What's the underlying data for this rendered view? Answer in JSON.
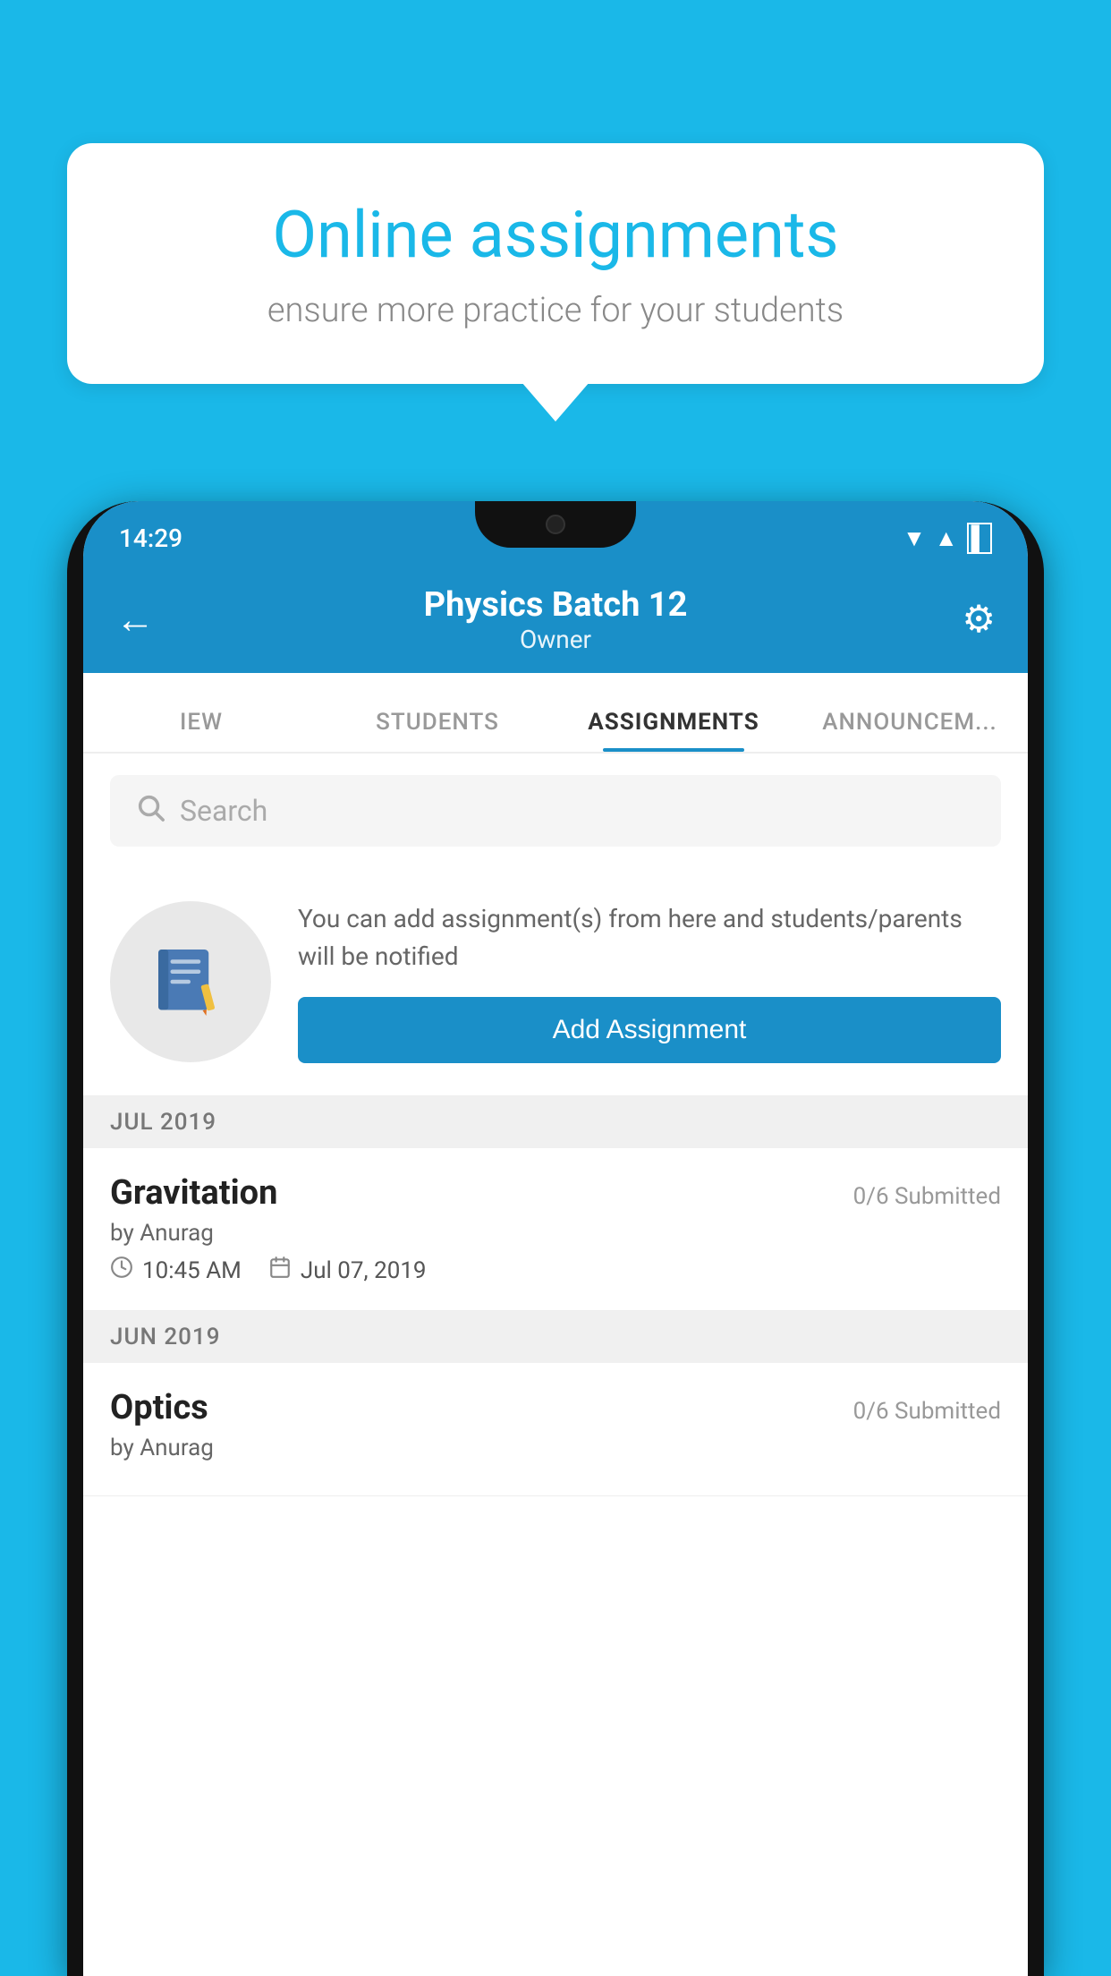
{
  "background_color": "#1ab8e8",
  "speech_bubble": {
    "title": "Online assignments",
    "subtitle": "ensure more practice for your students"
  },
  "status_bar": {
    "time": "14:29",
    "wifi_icon": "▼",
    "signal_icon": "▲",
    "battery_icon": "▌"
  },
  "header": {
    "title": "Physics Batch 12",
    "subtitle": "Owner",
    "back_label": "←",
    "settings_label": "⚙"
  },
  "tabs": [
    {
      "label": "IEW",
      "active": false
    },
    {
      "label": "STUDENTS",
      "active": false
    },
    {
      "label": "ASSIGNMENTS",
      "active": true
    },
    {
      "label": "ANNOUNCEM...",
      "active": false
    }
  ],
  "search": {
    "placeholder": "Search"
  },
  "promo": {
    "description": "You can add assignment(s) from here and students/parents will be notified",
    "button_label": "Add Assignment"
  },
  "assignments": [
    {
      "month_label": "JUL 2019",
      "items": [
        {
          "name": "Gravitation",
          "submitted": "0/6 Submitted",
          "by": "by Anurag",
          "time": "10:45 AM",
          "date": "Jul 07, 2019"
        }
      ]
    },
    {
      "month_label": "JUN 2019",
      "items": [
        {
          "name": "Optics",
          "submitted": "0/6 Submitted",
          "by": "by Anurag",
          "time": "",
          "date": ""
        }
      ]
    }
  ]
}
